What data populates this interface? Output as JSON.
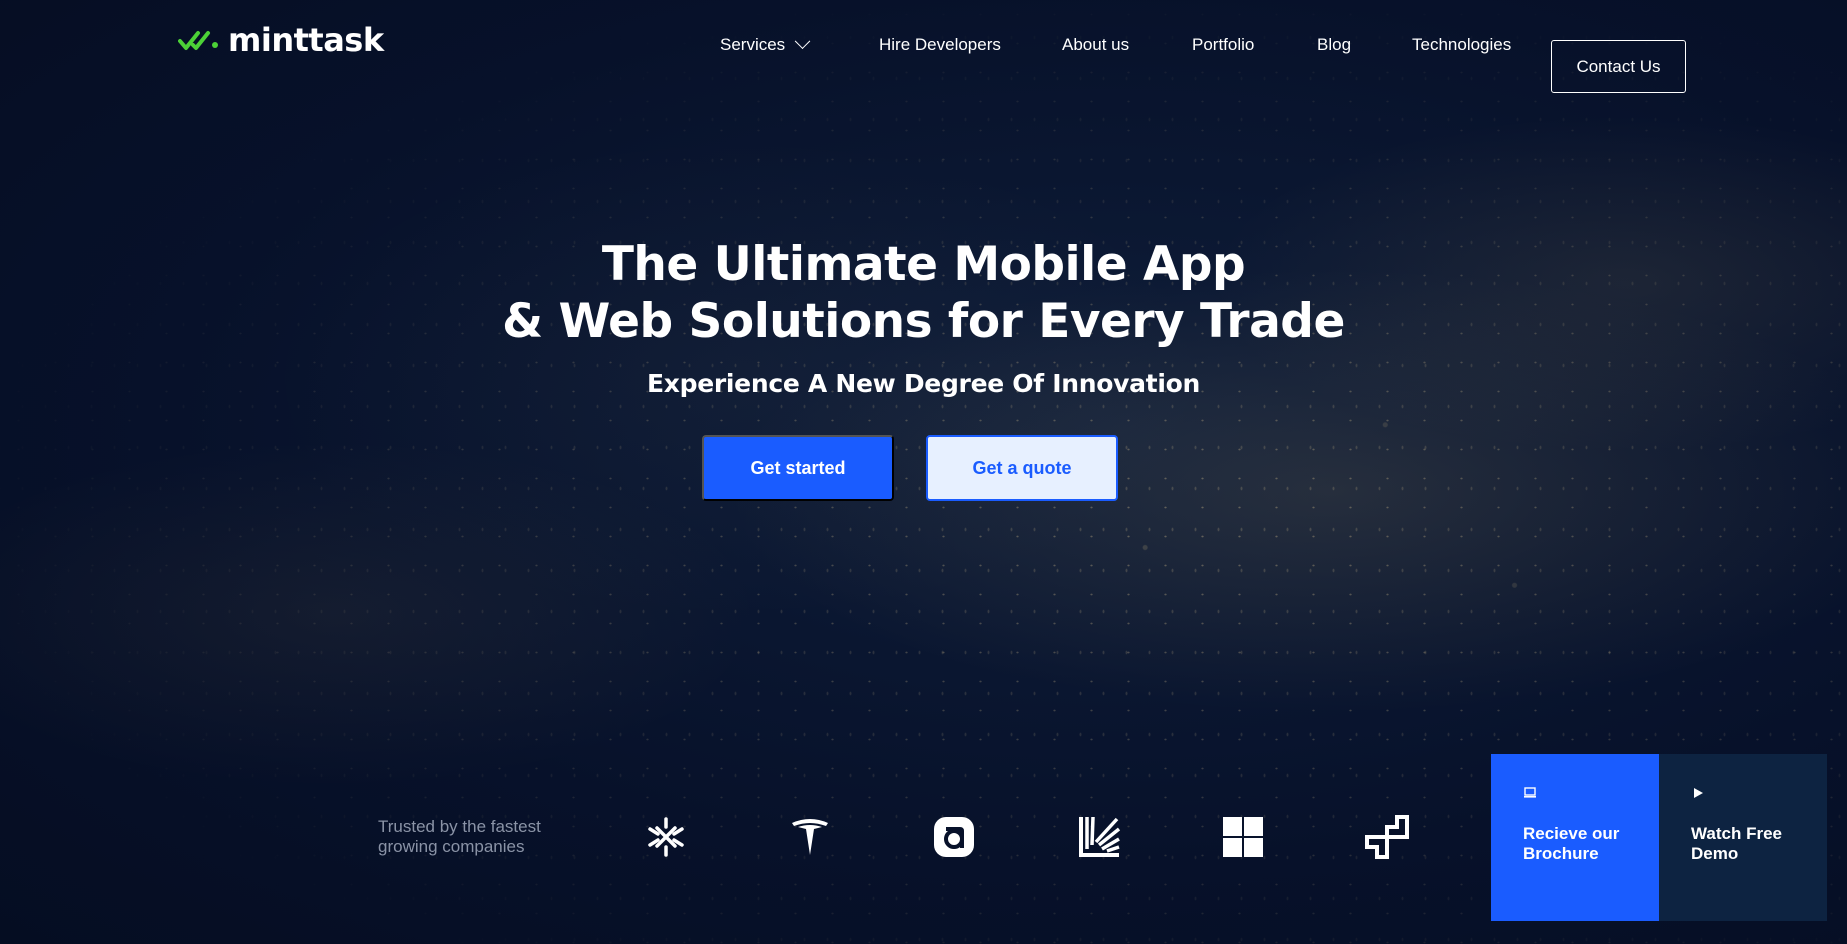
{
  "brand": {
    "name": "minttask",
    "accent": "#4cd137"
  },
  "nav": {
    "items": [
      {
        "label": "Services",
        "has_dropdown": true
      },
      {
        "label": "Hire Developers"
      },
      {
        "label": "About us"
      },
      {
        "label": "Portfolio"
      },
      {
        "label": "Blog"
      },
      {
        "label": "Technologies"
      }
    ],
    "contact_label": "Contact Us"
  },
  "hero": {
    "title_line1": "The Ultimate Mobile App",
    "title_line2": "& Web Solutions for Every Trade",
    "subtitle": "Experience A New Degree Of Innovation",
    "primary_cta": "Get started",
    "secondary_cta": "Get a quote"
  },
  "trusted": {
    "text": "Trusted by the fastest growing companies",
    "logos": [
      "spark-logo-icon",
      "tesla-logo-icon",
      "rounded-a-logo-icon",
      "striped-l-logo-icon",
      "windows-logo-icon",
      "squares-logo-icon"
    ]
  },
  "cards": {
    "brochure": {
      "label": "Recieve our Brochure",
      "icon": "laptop-icon"
    },
    "demo": {
      "label": "Watch Free Demo",
      "icon": "play-icon"
    }
  },
  "colors": {
    "primary": "#1a5cff",
    "background": "#07112a",
    "demo_card": "#0d2341",
    "secondary_button_bg": "#e7f0ff",
    "muted_text": "#8a93a6"
  }
}
